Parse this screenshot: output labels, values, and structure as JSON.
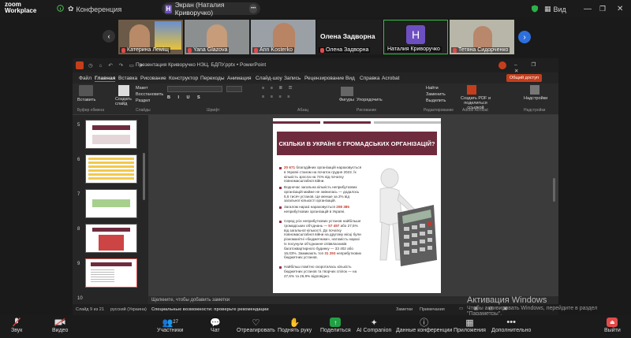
{
  "app": {
    "logo_line1": "zoom",
    "logo_line2": "Workplace"
  },
  "topbar": {
    "conference_label": "Конференция",
    "share_label": "Экран (Наталия Криворучко)",
    "share_badge": "H",
    "more": "•••",
    "view_label": "Вид"
  },
  "participants": [
    {
      "name": "Катерина Леміщ"
    },
    {
      "name": "Yana Glazova"
    },
    {
      "name": "Ann Kosterko"
    },
    {
      "name": "Олена Задворна",
      "big_label": "Олена Задворна"
    },
    {
      "name": "Наталия Криворучко",
      "badge": "H"
    },
    {
      "name": "Тетяна Сидорченко"
    }
  ],
  "ppt": {
    "title": "Презентация Криворучко НЭЦ. БДПУ.pptx  •  PowerPoint",
    "menu": [
      "Файл",
      "Главная",
      "Вставка",
      "Рисование",
      "Конструктор",
      "Переходы",
      "Анимация",
      "Слайд-шоу",
      "Запись",
      "Рецензирование",
      "Вид",
      "Справка",
      "Acrobat"
    ],
    "share_button": "Общий доступ",
    "ribbon": {
      "paste": "Вставить",
      "clipboard": "Буфер обмена",
      "new_slide": "Создать слайд",
      "layout": "Макет",
      "reset": "Восстановить",
      "section": "Раздел",
      "slides": "Слайды",
      "font": "Шрифт",
      "paragraph": "Абзац",
      "drawing": "Рисование",
      "shapes": "Фигуры",
      "arrange": "Упорядочить",
      "find": "Найти",
      "replace": "Заменить",
      "select": "Выделить",
      "editing": "Редактирование",
      "create_pdf": "Создать PDF и поделиться ссылкой",
      "acrobat": "Adobe Acrobat",
      "addins": "Надстройки",
      "addins_group": "Надстройки"
    },
    "slide_numbers": [
      "5",
      "6",
      "7",
      "8",
      "9",
      "10"
    ],
    "notes": "Щелкните, чтобы добавить заметки",
    "status": {
      "slide": "Слайд 9 из 21",
      "lang": "русский (Украина)",
      "accessibility": "Специальные возможности: проверьте рекомендации",
      "notes": "Заметки",
      "comments": "Примечания"
    }
  },
  "slide": {
    "title": "СКІЛЬКИ В УКРАЇНІ Є ГРОМАДСЬКИХ ОРГАНІЗАЦІЙ?",
    "b1_num": "20 671",
    "b1_text": " благодійних організацій нараховується в Україні станом на початок грудня 2023. Їх кількість зросла на 74% від початку повномасштабної війни.",
    "b2_text": "Водночас загальна кількість неприбуткових організацій майже не змінилась — додалось 5,6 тисяч установ. Це менше за 2% від загальної кількості організацій.",
    "b3_pre": "Загалом наразі нараховується ",
    "b3_num": "208 385",
    "b3_post": " неприбуткових організацій в Україні.",
    "b4_a": "Серед усіх неприбуткових установ найбільше громадських об'єднань — ",
    "b4_num1": "57 497",
    "b4_b": " або 27,5% від загальної кількості. До початку повномасштабної війни на другому місці були різноманітні «бюджетники», натомість наразі їх посунули об'єднання співвласників багатоквартирного будинку — 33 402 або 16,03%. Замикають топ ",
    "b4_num2": "31 293",
    "b4_c": " неприбуткових бюджетних установ.",
    "b5_text": "Найбільш помітно скоротилась кількість бюджетних установ та творчих спілок — на 27,6% та 26,9% відповідно."
  },
  "watermark": {
    "line1": "Активация Windows",
    "line2": "Чтобы активировать Windows, перейдите в раздел",
    "line3": "\"Параметры\"."
  },
  "bottom": {
    "audio": "Звук",
    "video": "Видео",
    "participants": "Участники",
    "participants_count": "27",
    "chat": "Чат",
    "react": "Отреагировать",
    "raise": "Поднять руку",
    "share": "Поделиться",
    "ai": "AI Companion",
    "info": "Данные конференции",
    "apps": "Приложения",
    "more": "Дополнительно",
    "leave": "Выйти"
  },
  "colors": {
    "accent": "#6f2b3e",
    "share_green": "#23a045",
    "ppt_orange": "#c43e1c"
  }
}
